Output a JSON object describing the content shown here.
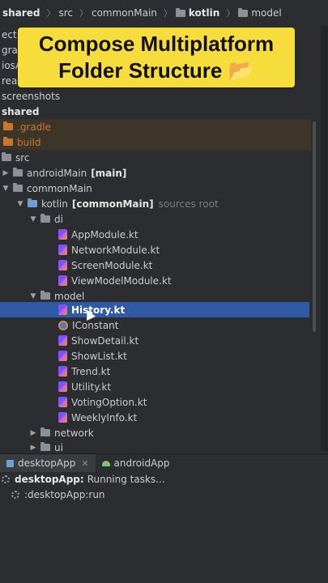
{
  "breadcrumb": {
    "items": [
      "shared",
      "src",
      "commonMain",
      "kotlin",
      "model"
    ]
  },
  "banner": {
    "line1": "Compose Multiplatform",
    "line2": "Folder Structure",
    "emoji": "📂"
  },
  "tree": {
    "partial_top": [
      "ect",
      "gra",
      "iosApp",
      "readme",
      "screenshots"
    ],
    "shared": "shared",
    "gradle": ".gradle",
    "build": "build",
    "src": "src",
    "androidMain": "androidMain",
    "androidMain_tag": "[main]",
    "commonMain": "commonMain",
    "kotlin": "kotlin",
    "kotlin_tag": "[commonMain]",
    "kotlin_hint": "sources root",
    "di": "di",
    "di_files": [
      "AppModule.kt",
      "NetworkModule.kt",
      "ScreenModule.kt",
      "ViewModelModule.kt"
    ],
    "model": "model",
    "model_files": [
      "History.kt",
      "IConstant",
      "ShowDetail.kt",
      "ShowList.kt",
      "Trend.kt",
      "Utility.kt",
      "VotingOption.kt",
      "WeeklyInfo.kt"
    ],
    "network": "network",
    "ui": "ui"
  },
  "run_panel": {
    "tabs": [
      "desktopApp",
      "androidApp"
    ],
    "task_title": "desktopApp:",
    "task_status": "Running tasks...",
    "task_sub": ":desktopApp:run"
  },
  "colors": {
    "banner_bg": "#f7dd3b",
    "selection": "#2e5aa6",
    "background": "#2b2d30"
  }
}
